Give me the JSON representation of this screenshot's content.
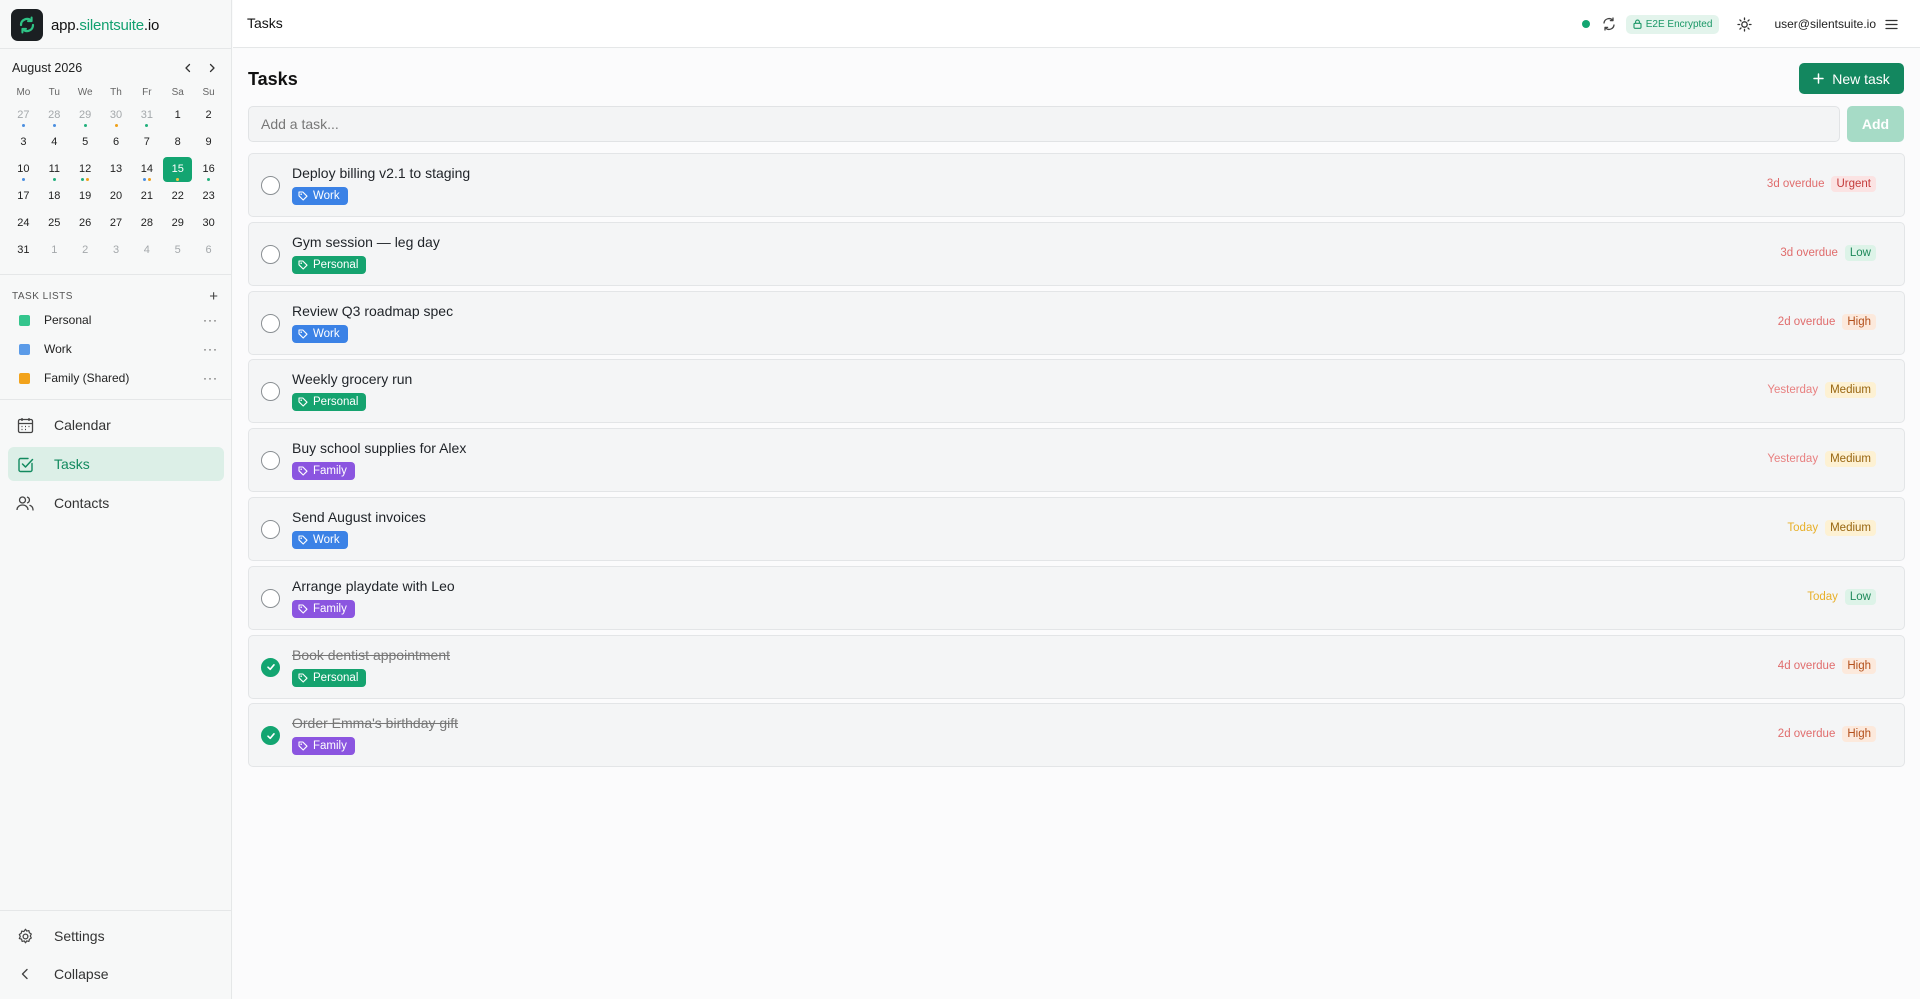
{
  "app": {
    "brand_prefix": "app.",
    "brand_accent": "silentsuite",
    "brand_suffix": ".io"
  },
  "mini_calendar": {
    "month_label": "August 2026",
    "weekdays": [
      "Mo",
      "Tu",
      "We",
      "Th",
      "Fr",
      "Sa",
      "Su"
    ],
    "weeks": [
      [
        {
          "d": "27",
          "m": true,
          "dots": [
            "#4b8fe0"
          ]
        },
        {
          "d": "28",
          "m": true,
          "dots": [
            "#4b8fe0"
          ]
        },
        {
          "d": "29",
          "m": true,
          "dots": [
            "#22b07d"
          ]
        },
        {
          "d": "30",
          "m": true,
          "dots": [
            "#f0a11a"
          ]
        },
        {
          "d": "31",
          "m": true,
          "dots": [
            "#22b07d"
          ]
        },
        {
          "d": "1"
        },
        {
          "d": "2"
        }
      ],
      [
        {
          "d": "3"
        },
        {
          "d": "4"
        },
        {
          "d": "5"
        },
        {
          "d": "6"
        },
        {
          "d": "7"
        },
        {
          "d": "8"
        },
        {
          "d": "9"
        }
      ],
      [
        {
          "d": "10",
          "dots": [
            "#4b8fe0"
          ]
        },
        {
          "d": "11",
          "dots": [
            "#22b07d"
          ]
        },
        {
          "d": "12",
          "dots": [
            "#22b07d",
            "#f0a11a"
          ]
        },
        {
          "d": "13"
        },
        {
          "d": "14",
          "dots": [
            "#4b8fe0",
            "#f0a11a"
          ]
        },
        {
          "d": "15",
          "today": true,
          "dots": [
            "#f6c343"
          ]
        },
        {
          "d": "16",
          "dots": [
            "#22b07d"
          ]
        }
      ],
      [
        {
          "d": "17"
        },
        {
          "d": "18"
        },
        {
          "d": "19"
        },
        {
          "d": "20"
        },
        {
          "d": "21"
        },
        {
          "d": "22"
        },
        {
          "d": "23"
        }
      ],
      [
        {
          "d": "24"
        },
        {
          "d": "25"
        },
        {
          "d": "26"
        },
        {
          "d": "27"
        },
        {
          "d": "28"
        },
        {
          "d": "29"
        },
        {
          "d": "30"
        }
      ],
      [
        {
          "d": "31"
        },
        {
          "d": "1",
          "m": true
        },
        {
          "d": "2",
          "m": true
        },
        {
          "d": "3",
          "m": true
        },
        {
          "d": "4",
          "m": true
        },
        {
          "d": "5",
          "m": true
        },
        {
          "d": "6",
          "m": true
        }
      ]
    ]
  },
  "task_lists": {
    "heading": "TASK LISTS",
    "add_label": "+",
    "more_label": "···",
    "items": [
      {
        "name": "Personal",
        "color": "#34c58d"
      },
      {
        "name": "Work",
        "color": "#5b9be8"
      },
      {
        "name": "Family (Shared)",
        "color": "#f2a31c"
      }
    ]
  },
  "nav": {
    "calendar": "Calendar",
    "tasks": "Tasks",
    "contacts": "Contacts",
    "settings": "Settings",
    "collapse": "Collapse"
  },
  "topbar": {
    "title": "Tasks",
    "encryption_badge": "E2E Encrypted",
    "user_email": "user@silentsuite.io"
  },
  "main": {
    "title": "Tasks",
    "new_task_label": "New task",
    "add_placeholder": "Add a task...",
    "add_button": "Add"
  },
  "tag_colors": {
    "Work": "#3b82e6",
    "Personal": "#15a36f",
    "Family": "#8b55e0"
  },
  "priority_styles": {
    "Urgent": {
      "bg": "#fbe3e3",
      "fg": "#c43b3b"
    },
    "High": {
      "bg": "#fce9dc",
      "fg": "#b4501b"
    },
    "Medium": {
      "bg": "#fdf1d3",
      "fg": "#98650f"
    },
    "Low": {
      "bg": "#ddf3e8",
      "fg": "#1f8a5b"
    }
  },
  "due_colors": {
    "overdue": "#e06c6c",
    "yesterday": "#e88080",
    "today": "#e8b02a"
  },
  "tasks": [
    {
      "title": "Deploy billing v2.1 to staging",
      "tag": "Work",
      "due": "3d overdue",
      "due_kind": "overdue",
      "priority": "Urgent",
      "done": false
    },
    {
      "title": "Gym session — leg day",
      "tag": "Personal",
      "due": "3d overdue",
      "due_kind": "overdue",
      "priority": "Low",
      "done": false
    },
    {
      "title": "Review Q3 roadmap spec",
      "tag": "Work",
      "due": "2d overdue",
      "due_kind": "overdue",
      "priority": "High",
      "done": false
    },
    {
      "title": "Weekly grocery run",
      "tag": "Personal",
      "due": "Yesterday",
      "due_kind": "yesterday",
      "priority": "Medium",
      "done": false
    },
    {
      "title": "Buy school supplies for Alex",
      "tag": "Family",
      "due": "Yesterday",
      "due_kind": "yesterday",
      "priority": "Medium",
      "done": false
    },
    {
      "title": "Send August invoices",
      "tag": "Work",
      "due": "Today",
      "due_kind": "today",
      "priority": "Medium",
      "done": false
    },
    {
      "title": "Arrange playdate with Leo",
      "tag": "Family",
      "due": "Today",
      "due_kind": "today",
      "priority": "Low",
      "done": false
    },
    {
      "title": "Book dentist appointment",
      "tag": "Personal",
      "due": "4d overdue",
      "due_kind": "overdue",
      "priority": "High",
      "done": true
    },
    {
      "title": "Order Emma's birthday gift",
      "tag": "Family",
      "due": "2d overdue",
      "due_kind": "overdue",
      "priority": "High",
      "done": true
    }
  ]
}
